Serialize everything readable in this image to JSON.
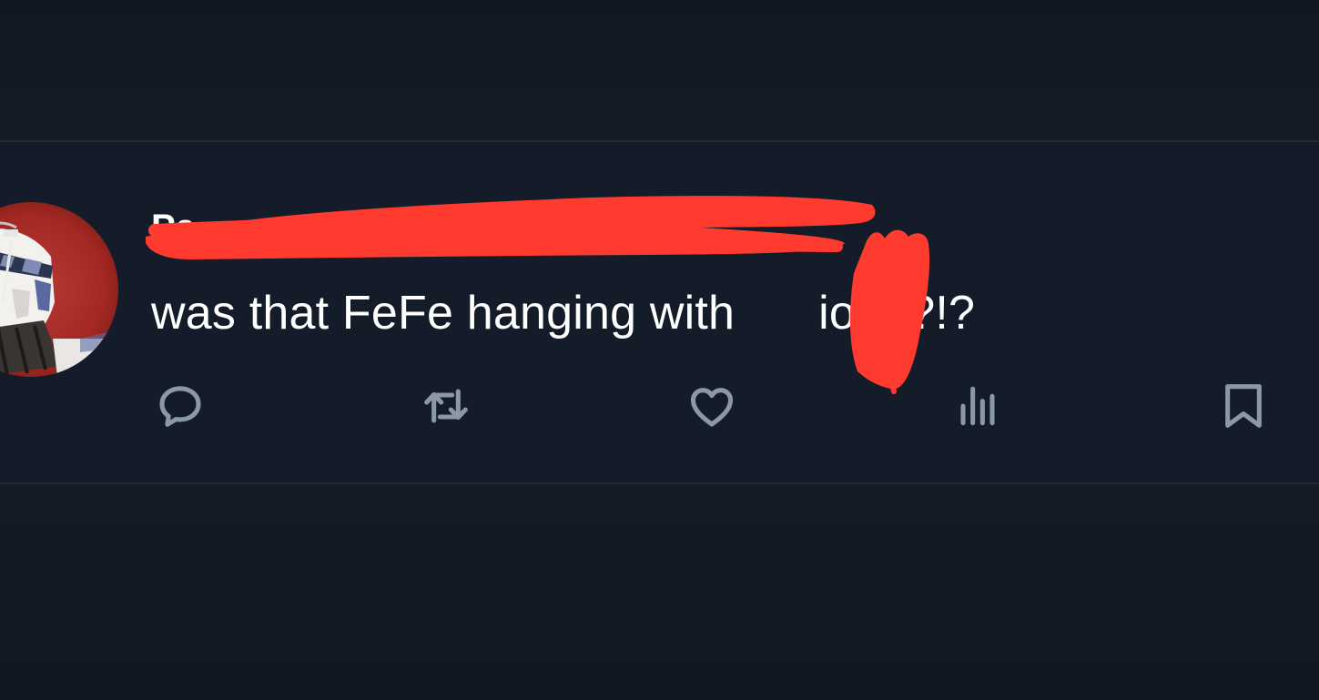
{
  "post": {
    "display_name": "Pa",
    "text_before": "was that FeFe hanging with",
    "text_after": "io$??!?"
  },
  "actions": [
    {
      "icon": "reply-icon",
      "label": "Reply"
    },
    {
      "icon": "repost-icon",
      "label": "Repost"
    },
    {
      "icon": "like-icon",
      "label": "Like"
    },
    {
      "icon": "views-icon",
      "label": "Views"
    },
    {
      "icon": "bookmark-icon",
      "label": "Bookmark"
    }
  ],
  "colors": {
    "background": "#121a26",
    "text": "#ffffff",
    "icon": "#8b98a5",
    "divider": "#202a36",
    "redaction": "#ff3b30"
  }
}
